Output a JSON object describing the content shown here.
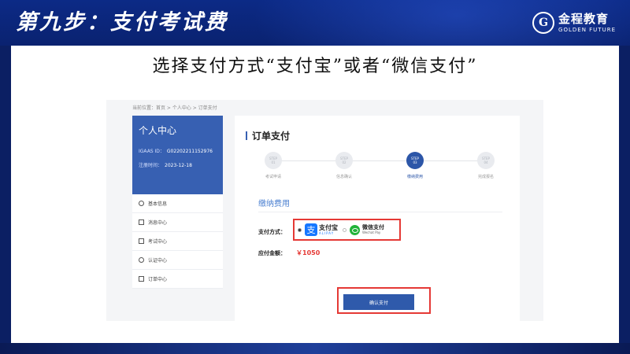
{
  "slide": {
    "title": "第九步：支付考试费",
    "instruction": "选择支付方式“支付宝”或者“微信支付”",
    "logo_cn": "金程教育",
    "logo_en": "GOLDEN FUTURE",
    "logo_mark": "G"
  },
  "web": {
    "breadcrumb": "当前位置：首页 > 个人中心 > 订单支付",
    "sidebar": {
      "title": "个人中心",
      "igaas_label": "IGAAS ID：",
      "igaas_value": "G02202211152976",
      "reg_label": "注册时间：",
      "reg_value": "2023-12-18",
      "items": [
        {
          "label": "基本信息",
          "icon": "clock-icon"
        },
        {
          "label": "消息中心",
          "icon": "message-icon"
        },
        {
          "label": "考试中心",
          "icon": "exam-icon"
        },
        {
          "label": "认证中心",
          "icon": "badge-icon"
        },
        {
          "label": "订单中心",
          "icon": "order-icon"
        }
      ]
    },
    "main": {
      "title": "订单支付",
      "steps": [
        {
          "step": "STEP",
          "num": "01",
          "label": "考试申请"
        },
        {
          "step": "STEP",
          "num": "02",
          "label": "信息确认"
        },
        {
          "step": "STEP",
          "num": "03",
          "label": "缴纳费用"
        },
        {
          "step": "STEP",
          "num": "04",
          "label": "完成报名"
        }
      ],
      "section_title": "缴纳费用",
      "pay_label": "支付方式：",
      "alipay_cn": "支付宝",
      "alipay_en": "ALIPAY",
      "alipay_icon_char": "支",
      "wechat_cn": "微信支付",
      "wechat_en": "Wechat Pay",
      "amount_label": "应付金额：",
      "amount_value": "￥1050",
      "confirm_button": "确认支付"
    }
  },
  "colors": {
    "brand_blue": "#3760b2",
    "highlight_red": "#e53935",
    "alipay_blue": "#1677ff",
    "wechat_green": "#21b339"
  }
}
